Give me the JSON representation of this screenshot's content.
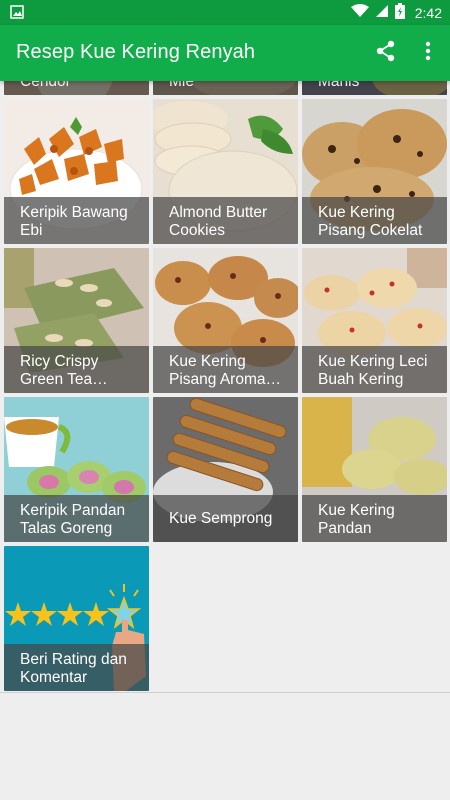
{
  "status_bar": {
    "time": "2:42",
    "icons": [
      "image-icon",
      "wifi-icon",
      "signal-icon",
      "battery-icon"
    ]
  },
  "app_bar": {
    "title": "Resep Kue Kering Renyah",
    "actions": [
      "share-icon",
      "more-vert-icon"
    ]
  },
  "colors": {
    "status_bar": "#0e9a3e",
    "app_bar": "#12ad4b",
    "background": "#eeeeee",
    "label_overlay": "rgba(70,70,70,0.72)"
  },
  "grid": {
    "partial_row": [
      {
        "label": "Cendol"
      },
      {
        "label": "Mie"
      },
      {
        "label": "Manis"
      }
    ],
    "tiles": [
      {
        "label": "Keripik Bawang Ebi"
      },
      {
        "label": "Almond Butter Cookies"
      },
      {
        "label": "Kue Kering Pisang Cokelat"
      },
      {
        "label": "Ricy Crispy Green Tea…"
      },
      {
        "label": "Kue Kering Pisang Aroma…"
      },
      {
        "label": "Kue Kering Leci Buah Kering"
      },
      {
        "label": "Keripik Pandan Talas Goreng"
      },
      {
        "label": "Kue Semprong"
      },
      {
        "label": "Kue Kering Pandan"
      },
      {
        "label": "Beri Rating dan Komentar"
      }
    ]
  }
}
